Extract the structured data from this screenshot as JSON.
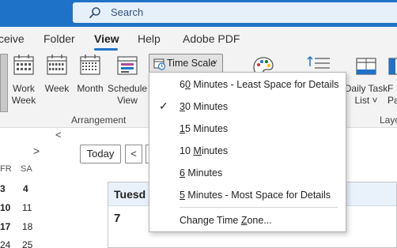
{
  "search": {
    "label": "Search"
  },
  "menu": {
    "tabs": [
      {
        "label": "ceive"
      },
      {
        "label": "Folder"
      },
      {
        "label": "View"
      },
      {
        "label": "Help"
      },
      {
        "label": "Adobe PDF"
      }
    ]
  },
  "ribbon": {
    "buttons": {
      "work_week": {
        "line1": "Work",
        "line2": "Week"
      },
      "week": {
        "line1": "Week"
      },
      "month": {
        "line1": "Month"
      },
      "schedule_view": {
        "line1": "Schedule",
        "line2": "View"
      },
      "daily_task_list": {
        "line1": "Daily Task",
        "line2": "List ˅"
      },
      "partial": {
        "line1": "F",
        "line2": "Pa"
      }
    },
    "time_scale": {
      "label": "Time Scale",
      "chevron": "˅"
    },
    "group_label": "Arrangement",
    "group_label2": "Layo"
  },
  "time_scale_menu": {
    "items": [
      {
        "pre": "6",
        "acc": "0",
        "post": " Minutes - Least Space for Details",
        "checked": false
      },
      {
        "pre": "",
        "acc": "3",
        "post": "0 Minutes",
        "checked": true
      },
      {
        "pre": "",
        "acc": "1",
        "post": "5 Minutes",
        "checked": false
      },
      {
        "pre": "10 ",
        "acc": "M",
        "post": "inutes",
        "checked": false
      },
      {
        "pre": "",
        "acc": "6",
        "post": " Minutes",
        "checked": false
      },
      {
        "pre": "",
        "acc": "5",
        "post": " Minutes - Most Space for Details",
        "checked": false
      }
    ],
    "change_tz": {
      "pre": "Change Time ",
      "acc": "Z",
      "post": "one..."
    },
    "check_mark": "✓"
  },
  "mini_calendar": {
    "prev": "<",
    "next": ">",
    "headers": [
      "FR",
      "SA"
    ],
    "rows": [
      [
        "3",
        "4"
      ],
      [
        "10",
        "11"
      ],
      [
        "17",
        "18"
      ],
      [
        "24",
        "25"
      ]
    ]
  },
  "calendar": {
    "today_label": "Today",
    "prev_label": "<",
    "day_name": "Tuesd",
    "day_number": "7"
  }
}
